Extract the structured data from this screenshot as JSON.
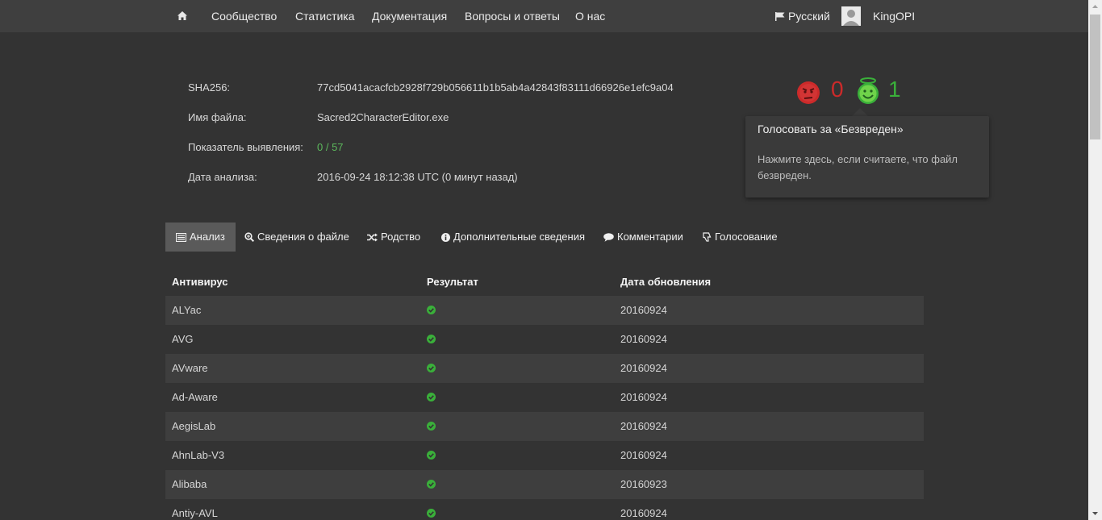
{
  "nav": {
    "items": [
      "Сообщество",
      "Статистика",
      "Документация",
      "Вопросы и ответы",
      "О нас"
    ],
    "home_icon": "home-icon",
    "language": "Русский",
    "user": "KingOPI"
  },
  "file_info": {
    "sha_label": "SHA256:",
    "sha_value": "77cd5041acacfcb2928f729b056611b1b5ab4a42843f83111d66926e1efc9a04",
    "name_label": "Имя файла:",
    "name_value": "Sacred2CharacterEditor.exe",
    "ratio_label": "Показатель выявления:",
    "ratio_value": "0 / 57",
    "date_label": "Дата анализа:",
    "date_value": "2016-09-24 18:12:38 UTC (0 минут назад)"
  },
  "votes": {
    "malicious_count": "0",
    "harmless_count": "1",
    "colors": {
      "malicious": "#cc2a2a",
      "harmless": "#3ab03a"
    }
  },
  "tooltip": {
    "title": "Голосовать за «Безвреден»",
    "body": "Нажмите здесь, если считаете, что файл безвреден."
  },
  "tabs": [
    {
      "label": "Анализ",
      "icon": "list-icon"
    },
    {
      "label": "Сведения о файле",
      "icon": "zoom-icon"
    },
    {
      "label": "Родство",
      "icon": "shuffle-icon"
    },
    {
      "label": "Дополнительные сведения",
      "icon": "info-icon"
    },
    {
      "label": "Комментарии",
      "icon": "comment-icon"
    },
    {
      "label": "Голосование",
      "icon": "thumbs-down-icon"
    }
  ],
  "table": {
    "headers": [
      "Антивирус",
      "Результат",
      "Дата обновления"
    ],
    "rows": [
      {
        "name": "ALYac",
        "result": "check-circle-icon",
        "date": "20160924"
      },
      {
        "name": "AVG",
        "result": "check-circle-icon",
        "date": "20160924"
      },
      {
        "name": "AVware",
        "result": "check-circle-icon",
        "date": "20160924"
      },
      {
        "name": "Ad-Aware",
        "result": "check-circle-icon",
        "date": "20160924"
      },
      {
        "name": "AegisLab",
        "result": "check-circle-icon",
        "date": "20160924"
      },
      {
        "name": "AhnLab-V3",
        "result": "check-circle-icon",
        "date": "20160924"
      },
      {
        "name": "Alibaba",
        "result": "check-circle-icon",
        "date": "20160923"
      },
      {
        "name": "Antiy-AVL",
        "result": "check-circle-icon",
        "date": "20160924"
      }
    ]
  }
}
